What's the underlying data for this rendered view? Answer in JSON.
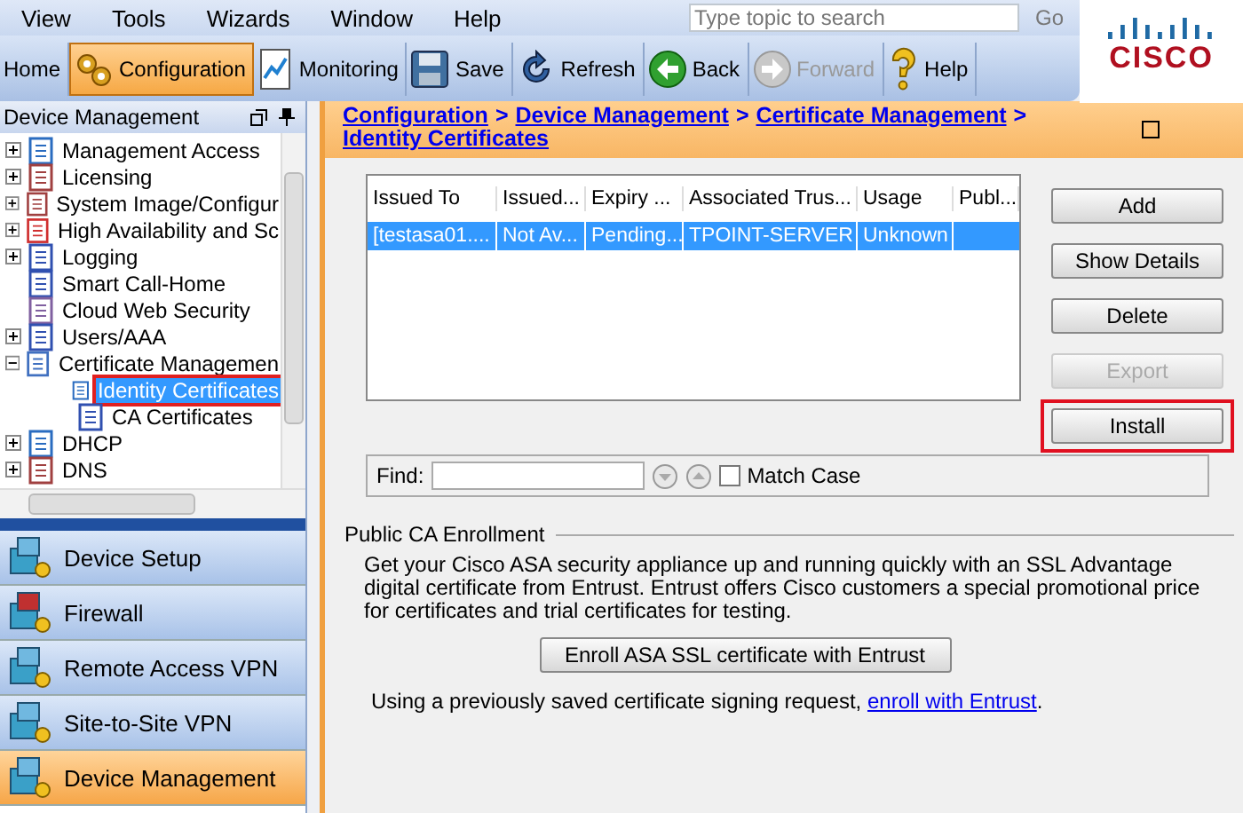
{
  "menu": [
    "View",
    "Tools",
    "Wizards",
    "Window",
    "Help"
  ],
  "search": {
    "placeholder": "Type topic to search",
    "button": "Go"
  },
  "logo": {
    "text": "CISCO"
  },
  "toolbar": [
    {
      "label": "Home",
      "selected": false,
      "disabled": false
    },
    {
      "label": "Configuration",
      "selected": true,
      "disabled": false
    },
    {
      "label": "Monitoring",
      "selected": false,
      "disabled": false
    },
    {
      "label": "Save",
      "selected": false,
      "disabled": false
    },
    {
      "label": "Refresh",
      "selected": false,
      "disabled": false
    },
    {
      "label": "Back",
      "selected": false,
      "disabled": false
    },
    {
      "label": "Forward",
      "selected": false,
      "disabled": true
    },
    {
      "label": "Help",
      "selected": false,
      "disabled": false
    }
  ],
  "left_panel": {
    "title": "Device Management",
    "tree": [
      {
        "label": "Management Access",
        "kind": "folder",
        "expanded": false,
        "selected": false
      },
      {
        "label": "Licensing",
        "kind": "folder",
        "expanded": false,
        "selected": false
      },
      {
        "label": "System Image/Configur",
        "kind": "folder",
        "expanded": false,
        "selected": false
      },
      {
        "label": "High Availability and Sc",
        "kind": "folder",
        "expanded": false,
        "selected": false
      },
      {
        "label": "Logging",
        "kind": "folder",
        "expanded": false,
        "selected": false
      },
      {
        "label": "Smart Call-Home",
        "kind": "leaf",
        "selected": false
      },
      {
        "label": "Cloud Web Security",
        "kind": "leaf",
        "selected": false
      },
      {
        "label": "Users/AAA",
        "kind": "folder",
        "expanded": false,
        "selected": false
      },
      {
        "label": "Certificate Managemen",
        "kind": "folder",
        "expanded": true,
        "selected": false,
        "children": [
          {
            "label": "Identity Certificates",
            "kind": "leaf",
            "selected": true
          },
          {
            "label": "CA Certificates",
            "kind": "leaf",
            "selected": false
          }
        ]
      },
      {
        "label": "DHCP",
        "kind": "folder",
        "expanded": false,
        "selected": false
      },
      {
        "label": "DNS",
        "kind": "folder",
        "expanded": false,
        "selected": false
      }
    ],
    "nav": [
      {
        "label": "Device Setup",
        "selected": false
      },
      {
        "label": "Firewall",
        "selected": false
      },
      {
        "label": "Remote Access VPN",
        "selected": false
      },
      {
        "label": "Site-to-Site VPN",
        "selected": false
      },
      {
        "label": "Device Management",
        "selected": true
      }
    ]
  },
  "breadcrumb": {
    "items": [
      "Configuration",
      "Device Management",
      "Certificate Management",
      "Identity Certificates"
    ],
    "separator": ">"
  },
  "table": {
    "columns": [
      "Issued To",
      "Issued...",
      "Expiry ...",
      "Associated Trus...",
      "Usage",
      "Publ..."
    ],
    "rows": [
      {
        "cells": [
          "[testasa01....",
          "Not Av...",
          "Pending...",
          "TPOINT-SERVER",
          "Unknown"
        ],
        "selected": true
      }
    ]
  },
  "buttons": [
    {
      "label": "Add",
      "disabled": false,
      "highlighted": false
    },
    {
      "label": "Show Details",
      "disabled": false,
      "highlighted": false
    },
    {
      "label": "Delete",
      "disabled": false,
      "highlighted": false
    },
    {
      "label": "Export",
      "disabled": true,
      "highlighted": false
    },
    {
      "label": "Install",
      "disabled": false,
      "highlighted": true
    }
  ],
  "find": {
    "label": "Find:",
    "match_case": {
      "label": "Match Case",
      "checked": false
    }
  },
  "enrollment": {
    "title": "Public CA Enrollment",
    "description": "Get your Cisco ASA security appliance up and running quickly with an SSL Advantage digital certificate from Entrust. Entrust offers Cisco customers a special promotional price for certificates and trial certificates for testing.",
    "button": "Enroll ASA SSL certificate with Entrust",
    "note": "Using a previously saved certificate signing request, ",
    "link": "enroll with Entrust",
    "note_end": "."
  }
}
